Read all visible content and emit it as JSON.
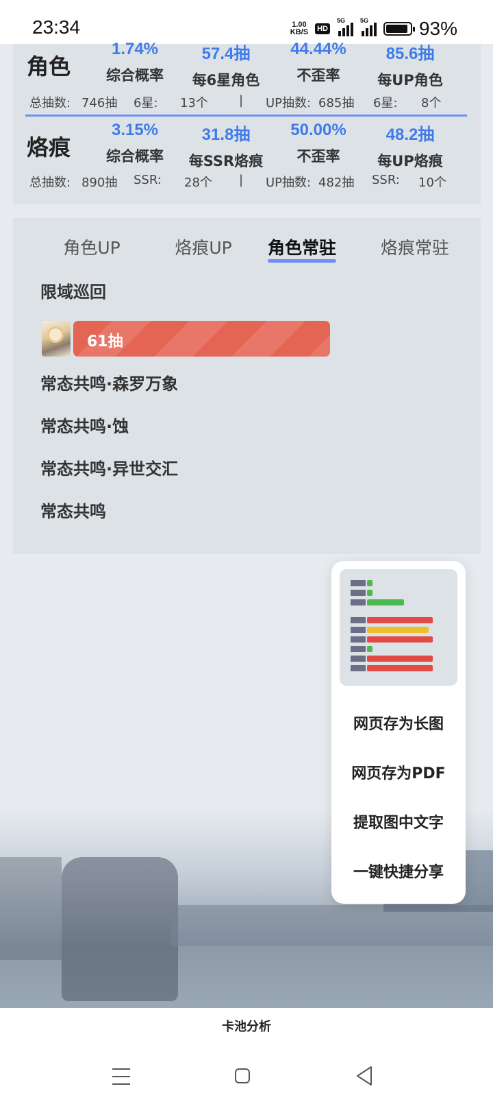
{
  "status_bar": {
    "time": "23:34",
    "speed_value": "1.00",
    "speed_unit": "KB/S",
    "hd_badge": "HD",
    "signal_1": "5G",
    "signal_2": "5G",
    "battery_percent": "93%"
  },
  "stats": {
    "character": {
      "label": "角色",
      "metrics": [
        {
          "value": "1.74%",
          "label": "综合概率"
        },
        {
          "value": "57.4抽",
          "label": "每6星角色"
        },
        {
          "value": "44.44%",
          "label": "不歪率"
        },
        {
          "value": "85.6抽",
          "label": "每UP角色"
        }
      ],
      "summary": {
        "total_label": "总抽数:",
        "total_value": "746抽",
        "rare_label": "6星:",
        "rare_value": "13个",
        "separator": "|",
        "up_label": "UP抽数:",
        "up_value": "685抽",
        "up_rare_label": "6星:",
        "up_rare_value": "8个"
      }
    },
    "imprint": {
      "label": "烙痕",
      "metrics": [
        {
          "value": "3.15%",
          "label": "综合概率"
        },
        {
          "value": "31.8抽",
          "label": "每SSR烙痕"
        },
        {
          "value": "50.00%",
          "label": "不歪率"
        },
        {
          "value": "48.2抽",
          "label": "每UP烙痕"
        }
      ],
      "summary": {
        "total_label": "总抽数:",
        "total_value": "890抽",
        "rare_label": "SSR:",
        "rare_value": "28个",
        "separator": "|",
        "up_label": "UP抽数:",
        "up_value": "482抽",
        "up_rare_label": "SSR:",
        "up_rare_value": "10个"
      }
    }
  },
  "tabs": [
    {
      "label": "角色UP",
      "active": false
    },
    {
      "label": "烙痕UP",
      "active": false
    },
    {
      "label": "角色常驻",
      "active": true
    },
    {
      "label": "烙痕常驻",
      "active": false
    }
  ],
  "pools": [
    {
      "title": "限域巡回"
    },
    {
      "title": "常态共鸣·森罗万象"
    },
    {
      "title": "常态共鸣·蚀"
    },
    {
      "title": "常态共鸣·异世交汇"
    },
    {
      "title": "常态共鸣"
    }
  ],
  "pull_bar": {
    "label": "61抽",
    "pulls": 61,
    "bar_color": "#e46553"
  },
  "popup_menu": {
    "items": [
      "网页存为长图",
      "网页存为PDF",
      "提取图中文字",
      "一键快捷分享"
    ]
  },
  "bottom_title": "卡池分析",
  "colors": {
    "accent": "#3f7bea",
    "divider": "#6f8ef0",
    "panel_bg": "#dde2e7",
    "bar_red": "#e46553"
  }
}
